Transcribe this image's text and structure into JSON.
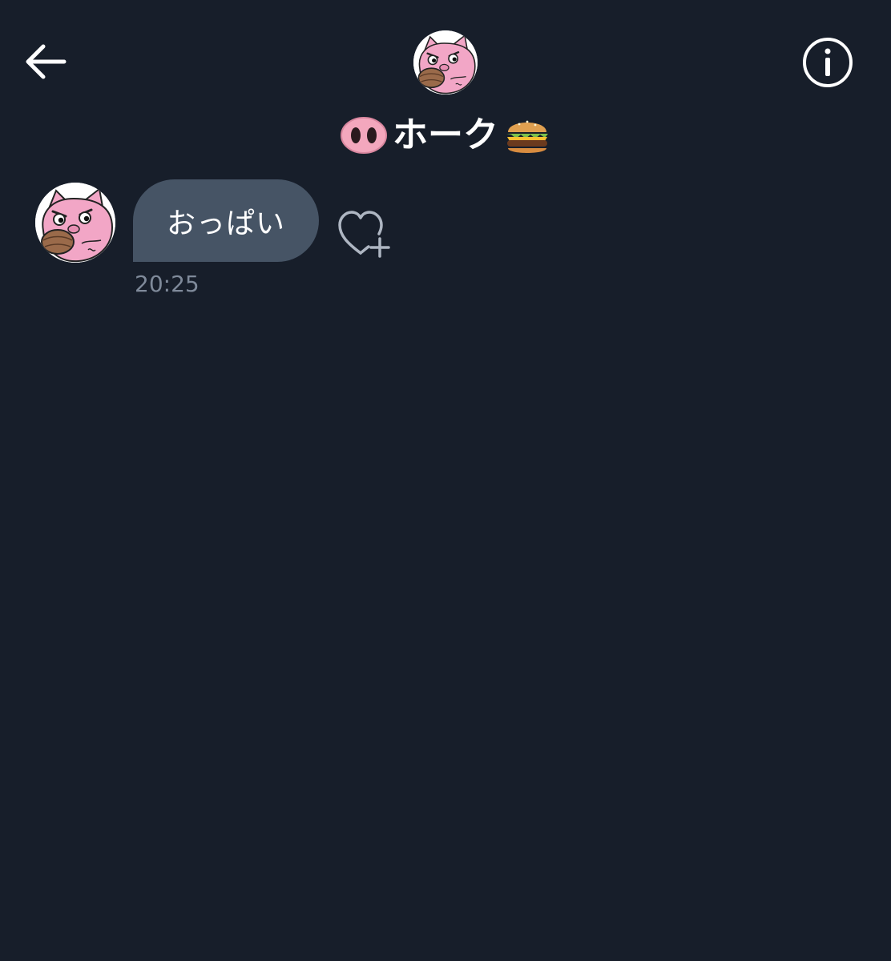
{
  "header": {
    "back_icon": "arrow-left-icon",
    "info_icon": "info-circle-icon",
    "avatar_icon": "pig-avatar",
    "title_prefix_icon": "pig-nose-emoji",
    "title": "ホーク",
    "title_suffix_icon": "hamburger-emoji"
  },
  "messages": [
    {
      "sender_avatar_icon": "pig-avatar",
      "text": "おっぱい",
      "time": "20:25",
      "reaction_icon": "heart-plus-icon"
    }
  ],
  "colors": {
    "background": "#171e2a",
    "bubble": "#465465",
    "text": "#ffffff",
    "timestamp": "#7f8a9a",
    "pig_pink": "#f2a6c6"
  }
}
